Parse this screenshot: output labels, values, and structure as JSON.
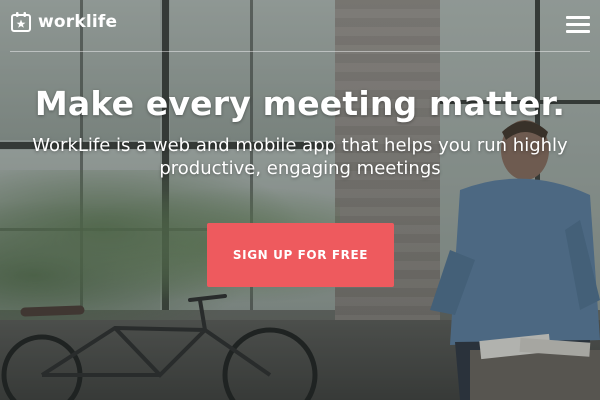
{
  "header": {
    "logo_text": "worklife",
    "logo_icon": "calendar-star-icon",
    "menu_icon": "hamburger-menu-icon"
  },
  "hero": {
    "headline": "Make every meeting matter.",
    "subheadline": "WorkLife is a web and mobile app that helps you run highly productive, engaging meetings",
    "cta_label": "SIGN UP FOR FREE"
  },
  "colors": {
    "cta_background": "#ee5a5e",
    "text": "#ffffff"
  }
}
